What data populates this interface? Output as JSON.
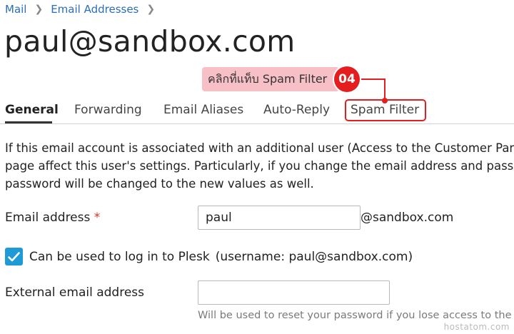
{
  "breadcrumb": {
    "items": [
      "Mail",
      "Email Addresses"
    ],
    "separator": ">"
  },
  "page_title": "paul@sandbox.com",
  "callout": {
    "text": "คลิกที่แท็บ Spam Filter",
    "step": "04",
    "color": "#e41e1e",
    "label_bg": "#f7c0c6"
  },
  "tabs": [
    {
      "label": "General",
      "active": true
    },
    {
      "label": "Forwarding",
      "active": false
    },
    {
      "label": "Email Aliases",
      "active": false
    },
    {
      "label": "Auto-Reply",
      "active": false
    },
    {
      "label": "Spam Filter",
      "active": false,
      "highlighted": true
    }
  ],
  "description": {
    "line1": "If this email account is associated with an additional user (Access to the Customer Panel",
    "line2": "page affect this user's settings. Particularly, if you change the email address and passwo",
    "line3": "password will be changed to the new values as well."
  },
  "form": {
    "email_label": "Email address",
    "required_mark": "*",
    "email_value": "paul",
    "domain_suffix": "@sandbox.com",
    "login_checkbox_label": "Can be used to log in to Plesk",
    "login_checked": true,
    "username_note": "(username: paul@sandbox.com)",
    "external_label": "External email address",
    "external_value": "",
    "external_hint": "Will be used to reset your password if you lose access to the pri"
  },
  "watermark": "hostatom.com",
  "colors": {
    "link": "#2a6fb5",
    "checkbox": "#1e9ad6",
    "required": "#d9342b"
  }
}
